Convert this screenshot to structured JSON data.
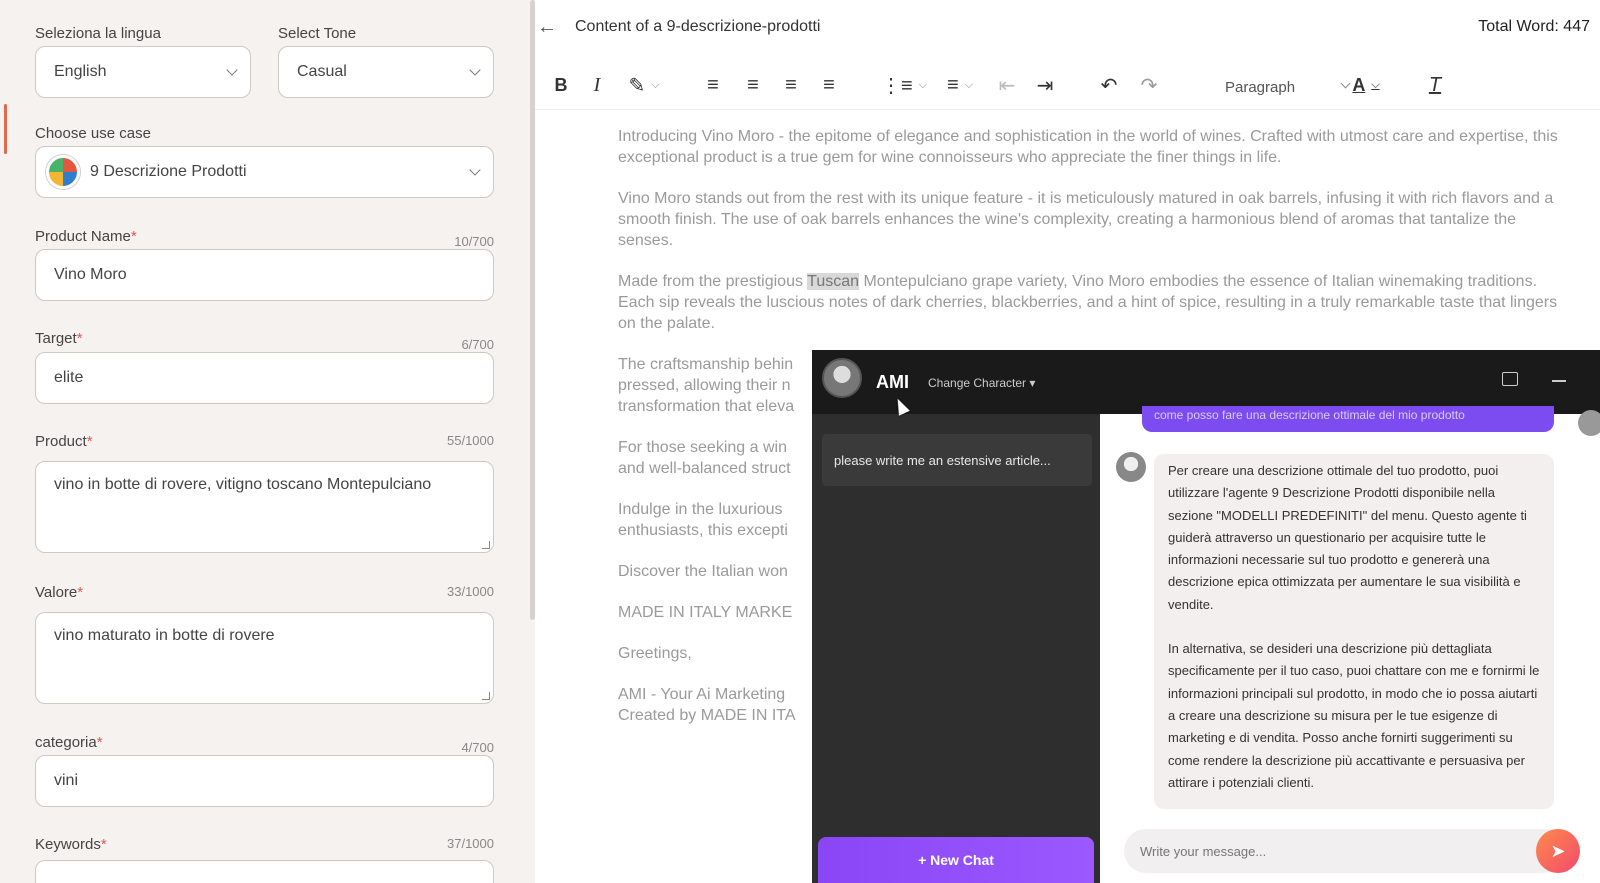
{
  "form": {
    "language": {
      "label": "Seleziona la lingua",
      "value": "English"
    },
    "tone": {
      "label": "Select Tone",
      "value": "Casual"
    },
    "use_case": {
      "label": "Choose use case",
      "value": "9 Descrizione Prodotti"
    },
    "product_name": {
      "label": "Product Name",
      "required": "*",
      "count": "10/700",
      "value": "Vino Moro"
    },
    "target": {
      "label": "Target",
      "required": "*",
      "count": "6/700",
      "value": "elite"
    },
    "product": {
      "label": "Product",
      "required": "*",
      "count": "55/1000",
      "value": "vino in botte di rovere, vitigno toscano Montepulciano"
    },
    "valore": {
      "label": "Valore",
      "required": "*",
      "count": "33/1000",
      "value": "vino maturato in botte di rovere"
    },
    "categoria": {
      "label": "categoria",
      "required": "*",
      "count": "4/700",
      "value": "vini"
    },
    "keywords": {
      "label": "Keywords",
      "required": "*",
      "count": "37/1000"
    }
  },
  "editor": {
    "back_icon": "arrow-left-icon",
    "title": "Content of a 9-descrizione-prodotti",
    "total_words": "Total Word: 447",
    "toolbar": {
      "paragraph_select": "Paragraph",
      "bold": "B",
      "italic": "I",
      "font_color": "A",
      "clear_format": "T"
    },
    "paragraphs": {
      "p1": "Introducing Vino Moro - the epitome of elegance and sophistication in the world of wines. Crafted with utmost care and expertise, this exceptional product is a true gem for wine connoisseurs who appreciate the finer things in life.",
      "p2": "Vino Moro stands out from the rest with its unique feature - it is meticulously matured in oak barrels, infusing it with rich flavors and a smooth finish. The use of oak barrels enhances the wine's complexity, creating a harmonious blend of aromas that tantalize the senses.",
      "p3_before": "Made from the prestigious ",
      "p3_highlight": "Tuscan",
      "p3_after": " Montepulciano grape variety, Vino Moro embodies the essence of Italian winemaking traditions. Each sip reveals the luscious notes of dark cherries, blackberries, and a hint of spice, resulting in a truly remarkable taste that lingers on the palate.",
      "p4": "The craftsmanship behin pressed, allowing their n transformation that eleva",
      "p5": "For those seeking a win and well-balanced struct",
      "p6": "Indulge in the luxurious enthusiasts, this excepti",
      "p7": "Discover the Italian won",
      "p8": "MADE IN ITALY MARKE",
      "p9": "Greetings,",
      "p10": "AMI - Your Ai Marketing Created by MADE IN ITA"
    }
  },
  "chat": {
    "name": "AMI",
    "change_character": "Change Character ▾",
    "history": [
      "please write me an estensive article..."
    ],
    "new_chat": "+ New Chat",
    "user_message": "come posso fare una descrizione ottimale del mio prodotto",
    "bot_reply_1": "Per creare una descrizione ottimale del tuo prodotto, puoi utilizzare l'agente 9 Descrizione Prodotti disponibile nella sezione \"MODELLI PREDEFINITI\" del menu. Questo agente ti guiderà attraverso un questionario per acquisire tutte le informazioni necessarie sul tuo prodotto e genererà una descrizione epica ottimizzata per aumentare le sua visibilità e vendite.",
    "bot_reply_2": "In alternativa, se desideri una descrizione più dettagliata specificamente per il tuo caso, puoi chattare con me e fornirmi le informazioni principali sul prodotto, in modo che io possa aiutarti a creare una descrizione su misura per le tue esigenze di marketing e di vendita. Posso anche fornirti suggerimenti su come rendere la descrizione più accattivante e persuasiva per attirare i potenziali clienti.",
    "input_placeholder": "Write your message..."
  }
}
